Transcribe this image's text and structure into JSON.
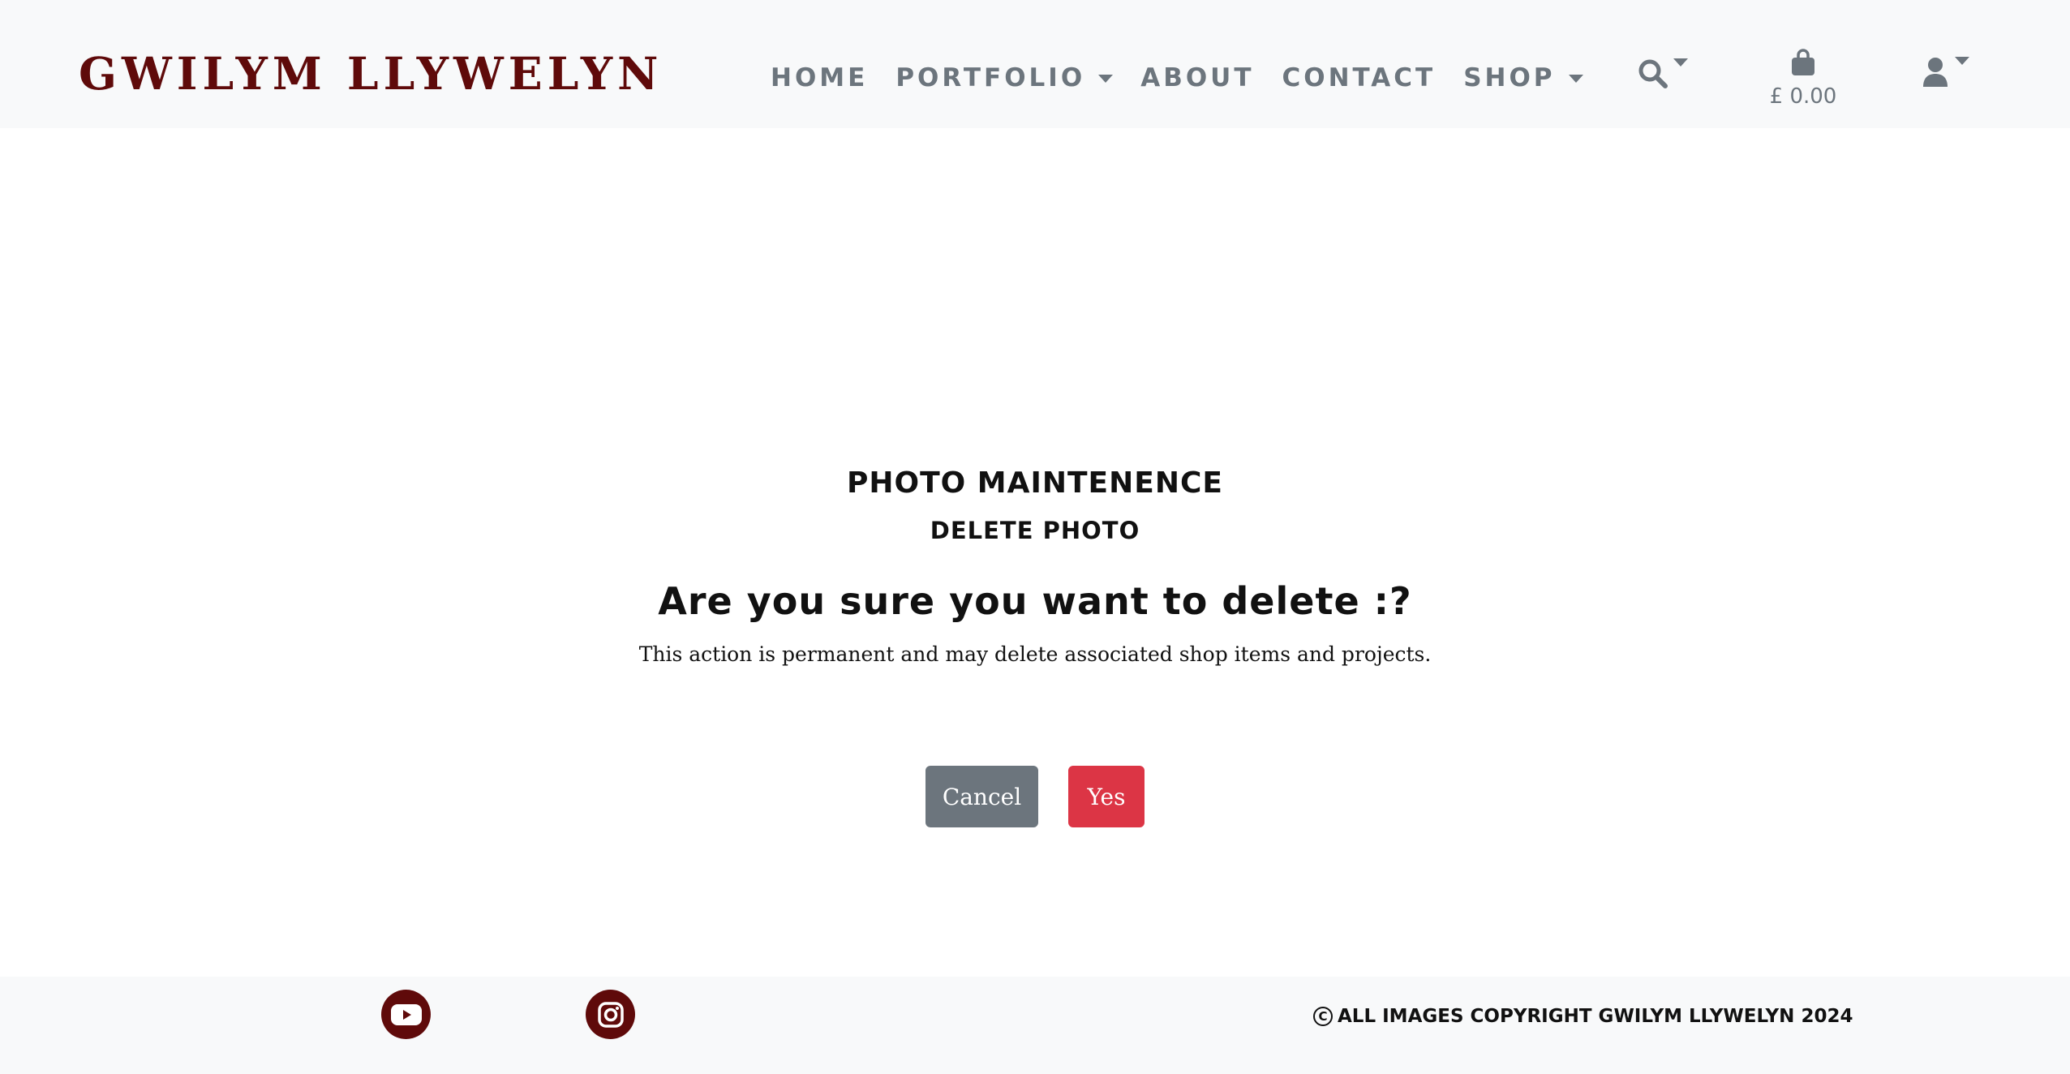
{
  "brand": {
    "name": "GWILYM LLYWELYN"
  },
  "nav": {
    "items": [
      {
        "label": "HOME",
        "dropdown": false
      },
      {
        "label": "PORTFOLIO",
        "dropdown": true
      },
      {
        "label": "ABOUT",
        "dropdown": false
      },
      {
        "label": "CONTACT",
        "dropdown": false
      },
      {
        "label": "SHOP",
        "dropdown": true
      }
    ]
  },
  "header_icons": {
    "search": "search-icon",
    "cart": "shopping-bag-icon",
    "user": "user-icon"
  },
  "cart": {
    "total": "£ 0.00"
  },
  "page": {
    "heading": "PHOTO MAINTENENCE",
    "subheading": "DELETE PHOTO",
    "question": "Are you sure you want to delete :?",
    "warning": "This action is permanent and may delete associated shop items and projects."
  },
  "buttons": {
    "cancel": "Cancel",
    "yes": "Yes"
  },
  "footer": {
    "social": [
      "youtube-icon",
      "instagram-icon"
    ],
    "copyright_symbol": "C",
    "copyright": "ALL IMAGES COPYRIGHT GWILYM LLYWELYN 2024"
  },
  "colors": {
    "brand": "#5f0a0a",
    "nav_text": "#6c757d",
    "header_bg": "#f8f9fa",
    "cancel_button": "#6c757d",
    "yes_button": "#dc3545"
  }
}
